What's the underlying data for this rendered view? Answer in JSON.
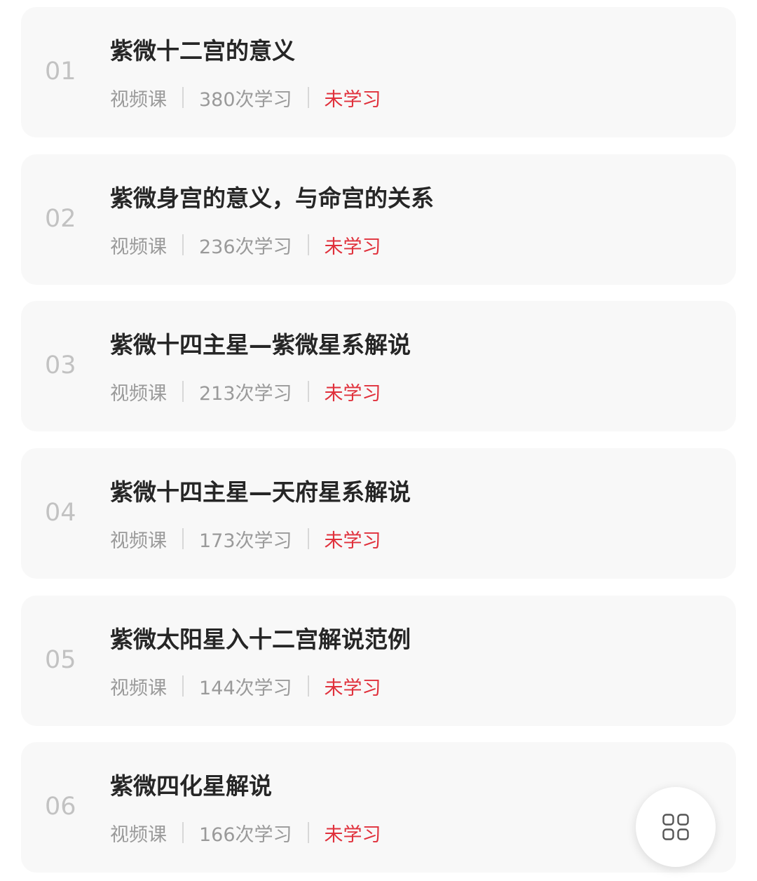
{
  "lessons": [
    {
      "num": "01",
      "title": "紫微十二宫的意义",
      "type": "视频课",
      "views": "380次学习",
      "status": "未学习"
    },
    {
      "num": "02",
      "title": "紫微身宫的意义，与命宫的关系",
      "type": "视频课",
      "views": "236次学习",
      "status": "未学习"
    },
    {
      "num": "03",
      "title": "紫微十四主星—紫微星系解说",
      "type": "视频课",
      "views": "213次学习",
      "status": "未学习"
    },
    {
      "num": "04",
      "title": "紫微十四主星—天府星系解说",
      "type": "视频课",
      "views": "173次学习",
      "status": "未学习"
    },
    {
      "num": "05",
      "title": "紫微太阳星入十二宫解说范例",
      "type": "视频课",
      "views": "144次学习",
      "status": "未学习"
    },
    {
      "num": "06",
      "title": "紫微四化星解说",
      "type": "视频课",
      "views": "166次学习",
      "status": "未学习"
    }
  ],
  "fab": {
    "icon": "grid-icon"
  },
  "colors": {
    "card_bg": "#f8f8f8",
    "status_unlearned": "#e0303b",
    "number": "#c2c2c2",
    "meta": "#9a9a9a",
    "title": "#262626"
  }
}
